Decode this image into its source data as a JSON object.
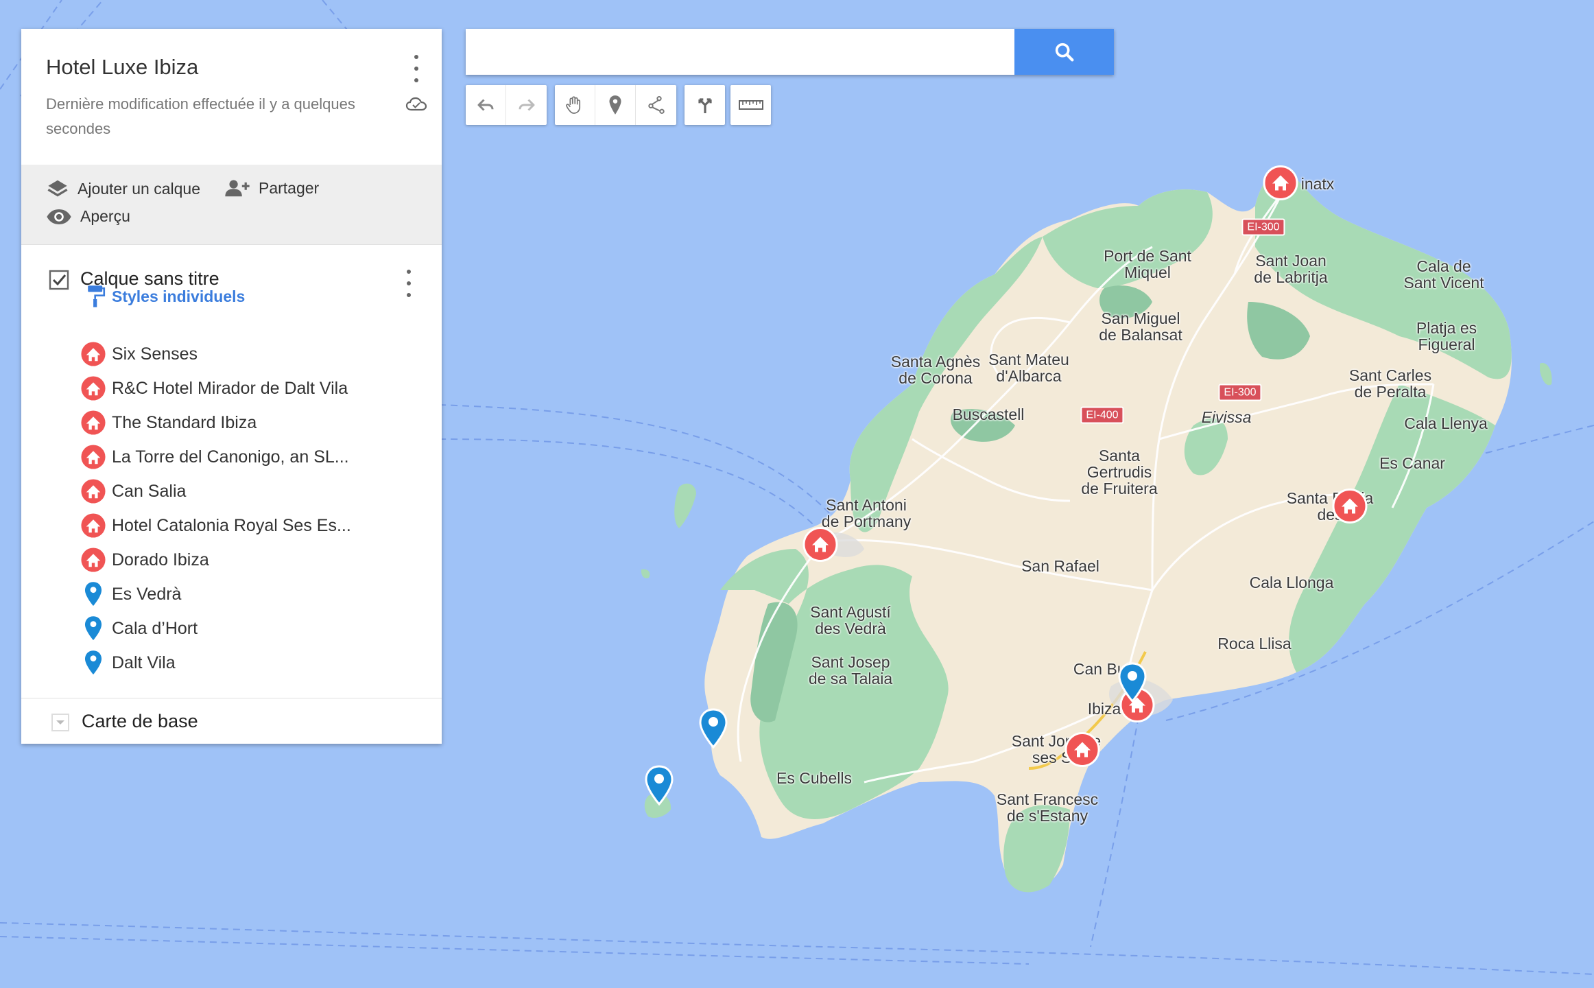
{
  "map_title": "Hotel Luxe Ibiza",
  "map_subtitle": "Dernière modification effectuée il y a quelques secondes",
  "actions": {
    "add_layer": "Ajouter un calque",
    "share": "Partager",
    "preview": "Aperçu"
  },
  "layer": {
    "title": "Calque sans titre",
    "checked": true,
    "styles_link": "Styles individuels",
    "items": [
      {
        "label": "Six Senses",
        "icon": "hotel-icon",
        "color": "#f05454"
      },
      {
        "label": "R&C Hotel Mirador de Dalt Vila",
        "icon": "hotel-icon",
        "color": "#f05454"
      },
      {
        "label": "The Standard Ibiza",
        "icon": "hotel-icon",
        "color": "#f05454"
      },
      {
        "label": "La Torre del Canonigo, an SL...",
        "icon": "hotel-icon",
        "color": "#f05454"
      },
      {
        "label": "Can Salia",
        "icon": "hotel-icon",
        "color": "#f05454"
      },
      {
        "label": "Hotel Catalonia Royal Ses Es...",
        "icon": "hotel-icon",
        "color": "#f05454"
      },
      {
        "label": "Dorado Ibiza",
        "icon": "hotel-icon",
        "color": "#f05454"
      },
      {
        "label": "Es Vedrà",
        "icon": "pin-icon",
        "color": "#1a8ad6"
      },
      {
        "label": "Cala d’Hort",
        "icon": "pin-icon",
        "color": "#1a8ad6"
      },
      {
        "label": "Dalt Vila",
        "icon": "pin-icon",
        "color": "#1a8ad6"
      }
    ]
  },
  "basemap_label": "Carte de base",
  "search": {
    "value": "",
    "placeholder": ""
  },
  "colors": {
    "sea": "#9fc2f7",
    "land": "#f3ead8",
    "green": "#a8dab5",
    "hotel_marker": "#f05454",
    "pin_marker": "#1a8ad6",
    "accent": "#4a8ff0"
  },
  "map": {
    "places": [
      {
        "name": "inatx"
      },
      {
        "name": "Port de Sant\nMiquel"
      },
      {
        "name": "Sant Joan\nde Labritja"
      },
      {
        "name": "Cala de\nSant Vicent"
      },
      {
        "name": "San Miguel\nde Balansat"
      },
      {
        "name": "Platja es\nFigueral"
      },
      {
        "name": "Santa Agnès\nde Corona"
      },
      {
        "name": "Sant Mateu\nd'Albarca"
      },
      {
        "name": "Sant Carles\nde Peralta"
      },
      {
        "name": "Buscastell"
      },
      {
        "name": "Eivissa"
      },
      {
        "name": "Cala Llenya"
      },
      {
        "name": "Santa\nGertrudis\nde Fruitera"
      },
      {
        "name": "Es Canar"
      },
      {
        "name": "Sant Antoni\nde Portmany"
      },
      {
        "name": "Santa E   ria\ndes"
      },
      {
        "name": "San Rafael"
      },
      {
        "name": "Cala Llonga"
      },
      {
        "name": "Sant Agustí\ndes Vedrà"
      },
      {
        "name": "Roca Llisa"
      },
      {
        "name": "Sant Josep\nde sa Talaia"
      },
      {
        "name": "Can Bufi"
      },
      {
        "name": "Ibiza"
      },
      {
        "name": "Sant Jor   de\nses Sa"
      },
      {
        "name": "Es Cubells"
      },
      {
        "name": "Sant Francesc\nde s'Estany"
      }
    ],
    "roads": [
      "EI-300",
      "EI-300",
      "EI-400"
    ]
  }
}
